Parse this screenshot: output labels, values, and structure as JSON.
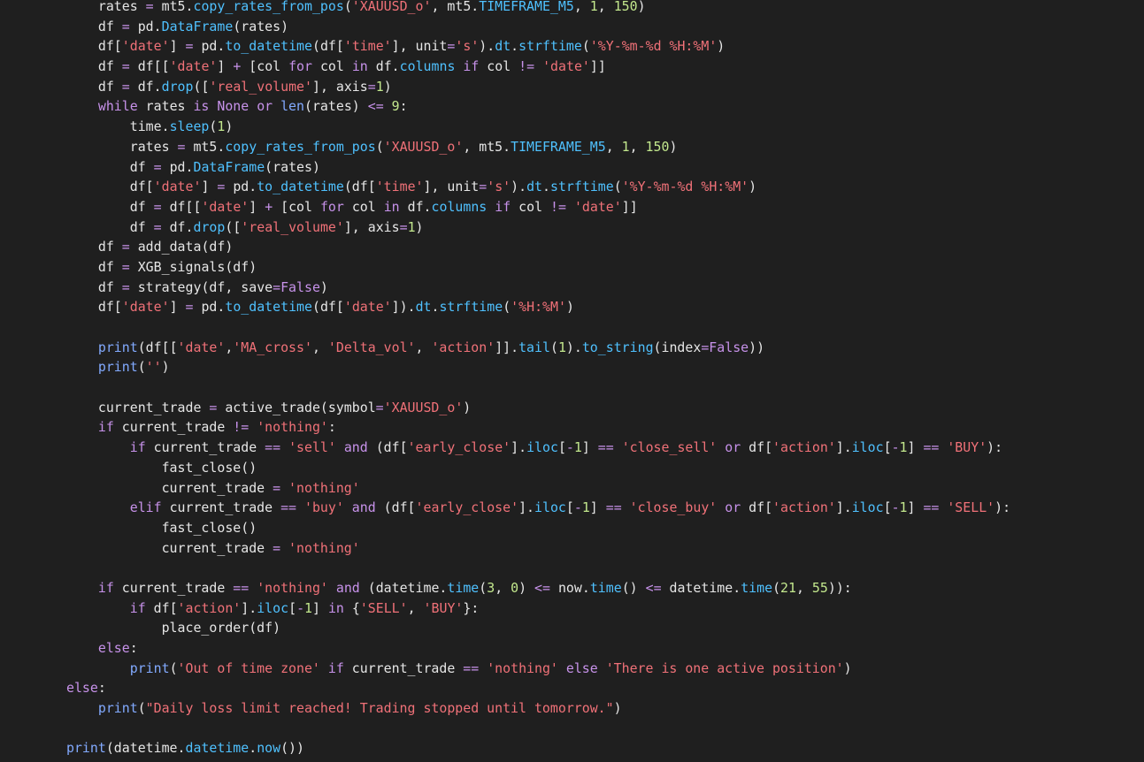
{
  "colors": {
    "background": "#1f1f1f",
    "plain": "#e6e6e6",
    "keyword": "#c792ea",
    "builtin": "#82aaff",
    "function": "#4fc1ff",
    "string": "#f07178",
    "number": "#c3e88d",
    "operator": "#c792ea",
    "bracket": "#ffd700"
  },
  "code_lines": [
    {
      "indent": 1,
      "tokens": [
        [
          "p",
          "rates "
        ],
        [
          "o",
          "= "
        ],
        [
          "p",
          "mt5."
        ],
        [
          "f",
          "copy_rates_from_pos"
        ],
        [
          "p",
          "("
        ],
        [
          "s",
          "'XAUUSD_o'"
        ],
        [
          "p",
          ", mt5."
        ],
        [
          "f",
          "TIMEFRAME_M5"
        ],
        [
          "p",
          ", "
        ],
        [
          "n",
          "1"
        ],
        [
          "p",
          ", "
        ],
        [
          "n",
          "150"
        ],
        [
          "p",
          ")"
        ]
      ]
    },
    {
      "indent": 1,
      "tokens": [
        [
          "p",
          "df "
        ],
        [
          "o",
          "= "
        ],
        [
          "p",
          "pd."
        ],
        [
          "f",
          "DataFrame"
        ],
        [
          "p",
          "(rates)"
        ]
      ]
    },
    {
      "indent": 1,
      "tokens": [
        [
          "p",
          "df["
        ],
        [
          "s",
          "'date'"
        ],
        [
          "p",
          "] "
        ],
        [
          "o",
          "= "
        ],
        [
          "p",
          "pd."
        ],
        [
          "f",
          "to_datetime"
        ],
        [
          "p",
          "(df["
        ],
        [
          "s",
          "'time'"
        ],
        [
          "p",
          "], unit"
        ],
        [
          "o",
          "="
        ],
        [
          "s",
          "'s'"
        ],
        [
          "p",
          ")."
        ],
        [
          "f",
          "dt"
        ],
        [
          "p",
          "."
        ],
        [
          "f",
          "strftime"
        ],
        [
          "p",
          "("
        ],
        [
          "s",
          "'%Y-%m-%d %H:%M'"
        ],
        [
          "p",
          ")"
        ]
      ]
    },
    {
      "indent": 1,
      "tokens": [
        [
          "p",
          "df "
        ],
        [
          "o",
          "= "
        ],
        [
          "p",
          "df[["
        ],
        [
          "s",
          "'date'"
        ],
        [
          "p",
          "] "
        ],
        [
          "o",
          "+ "
        ],
        [
          "p",
          "[col "
        ],
        [
          "k",
          "for "
        ],
        [
          "p",
          "col "
        ],
        [
          "k",
          "in "
        ],
        [
          "p",
          "df."
        ],
        [
          "f",
          "columns "
        ],
        [
          "k",
          "if "
        ],
        [
          "p",
          "col "
        ],
        [
          "o",
          "!= "
        ],
        [
          "s",
          "'date'"
        ],
        [
          "p",
          "]]"
        ]
      ]
    },
    {
      "indent": 1,
      "tokens": [
        [
          "p",
          "df "
        ],
        [
          "o",
          "= "
        ],
        [
          "p",
          "df."
        ],
        [
          "f",
          "drop"
        ],
        [
          "p",
          "(["
        ],
        [
          "s",
          "'real_volume'"
        ],
        [
          "p",
          "], axis"
        ],
        [
          "o",
          "="
        ],
        [
          "n",
          "1"
        ],
        [
          "p",
          ")"
        ]
      ]
    },
    {
      "indent": 1,
      "tokens": [
        [
          "k",
          "while "
        ],
        [
          "p",
          "rates "
        ],
        [
          "k",
          "is None or "
        ],
        [
          "b",
          "len"
        ],
        [
          "p",
          "(rates) "
        ],
        [
          "o",
          "<= "
        ],
        [
          "n",
          "9"
        ],
        [
          "p",
          ":"
        ]
      ]
    },
    {
      "indent": 2,
      "tokens": [
        [
          "p",
          "time."
        ],
        [
          "f",
          "sleep"
        ],
        [
          "p",
          "("
        ],
        [
          "n",
          "1"
        ],
        [
          "p",
          ")"
        ]
      ]
    },
    {
      "indent": 2,
      "tokens": [
        [
          "p",
          "rates "
        ],
        [
          "o",
          "= "
        ],
        [
          "p",
          "mt5."
        ],
        [
          "f",
          "copy_rates_from_pos"
        ],
        [
          "p",
          "("
        ],
        [
          "s",
          "'XAUUSD_o'"
        ],
        [
          "p",
          ", mt5."
        ],
        [
          "f",
          "TIMEFRAME_M5"
        ],
        [
          "p",
          ", "
        ],
        [
          "n",
          "1"
        ],
        [
          "p",
          ", "
        ],
        [
          "n",
          "150"
        ],
        [
          "p",
          ")"
        ]
      ]
    },
    {
      "indent": 2,
      "tokens": [
        [
          "p",
          "df "
        ],
        [
          "o",
          "= "
        ],
        [
          "p",
          "pd."
        ],
        [
          "f",
          "DataFrame"
        ],
        [
          "p",
          "(rates)"
        ]
      ]
    },
    {
      "indent": 2,
      "tokens": [
        [
          "p",
          "df["
        ],
        [
          "s",
          "'date'"
        ],
        [
          "p",
          "] "
        ],
        [
          "o",
          "= "
        ],
        [
          "p",
          "pd."
        ],
        [
          "f",
          "to_datetime"
        ],
        [
          "p",
          "(df["
        ],
        [
          "s",
          "'time'"
        ],
        [
          "p",
          "], unit"
        ],
        [
          "o",
          "="
        ],
        [
          "s",
          "'s'"
        ],
        [
          "p",
          ")."
        ],
        [
          "f",
          "dt"
        ],
        [
          "p",
          "."
        ],
        [
          "f",
          "strftime"
        ],
        [
          "p",
          "("
        ],
        [
          "s",
          "'%Y-%m-%d %H:%M'"
        ],
        [
          "p",
          ")"
        ]
      ]
    },
    {
      "indent": 2,
      "tokens": [
        [
          "p",
          "df "
        ],
        [
          "o",
          "= "
        ],
        [
          "p",
          "df[["
        ],
        [
          "s",
          "'date'"
        ],
        [
          "p",
          "] "
        ],
        [
          "o",
          "+ "
        ],
        [
          "p",
          "[col "
        ],
        [
          "k",
          "for "
        ],
        [
          "p",
          "col "
        ],
        [
          "k",
          "in "
        ],
        [
          "p",
          "df."
        ],
        [
          "f",
          "columns "
        ],
        [
          "k",
          "if "
        ],
        [
          "p",
          "col "
        ],
        [
          "o",
          "!= "
        ],
        [
          "s",
          "'date'"
        ],
        [
          "p",
          "]]"
        ]
      ]
    },
    {
      "indent": 2,
      "tokens": [
        [
          "p",
          "df "
        ],
        [
          "o",
          "= "
        ],
        [
          "p",
          "df."
        ],
        [
          "f",
          "drop"
        ],
        [
          "p",
          "(["
        ],
        [
          "s",
          "'real_volume'"
        ],
        [
          "p",
          "], axis"
        ],
        [
          "o",
          "="
        ],
        [
          "n",
          "1"
        ],
        [
          "p",
          ")"
        ]
      ]
    },
    {
      "indent": 1,
      "tokens": [
        [
          "p",
          "df "
        ],
        [
          "o",
          "= "
        ],
        [
          "p",
          "add_data(df)"
        ]
      ]
    },
    {
      "indent": 1,
      "tokens": [
        [
          "p",
          "df "
        ],
        [
          "o",
          "= "
        ],
        [
          "p",
          "XGB_signals(df)"
        ]
      ]
    },
    {
      "indent": 1,
      "tokens": [
        [
          "p",
          "df "
        ],
        [
          "o",
          "= "
        ],
        [
          "p",
          "strategy(df, save"
        ],
        [
          "o",
          "="
        ],
        [
          "k",
          "False"
        ],
        [
          "p",
          ")"
        ]
      ]
    },
    {
      "indent": 1,
      "tokens": [
        [
          "p",
          "df["
        ],
        [
          "s",
          "'date'"
        ],
        [
          "p",
          "] "
        ],
        [
          "o",
          "= "
        ],
        [
          "p",
          "pd."
        ],
        [
          "f",
          "to_datetime"
        ],
        [
          "p",
          "(df["
        ],
        [
          "s",
          "'date'"
        ],
        [
          "p",
          "])."
        ],
        [
          "f",
          "dt"
        ],
        [
          "p",
          "."
        ],
        [
          "f",
          "strftime"
        ],
        [
          "p",
          "("
        ],
        [
          "s",
          "'%H:%M'"
        ],
        [
          "p",
          ")"
        ]
      ]
    },
    {
      "indent": 0,
      "tokens": []
    },
    {
      "indent": 1,
      "tokens": [
        [
          "b",
          "print"
        ],
        [
          "p",
          "(df[["
        ],
        [
          "s",
          "'date'"
        ],
        [
          "p",
          ","
        ],
        [
          "s",
          "'MA_cross'"
        ],
        [
          "p",
          ", "
        ],
        [
          "s",
          "'Delta_vol'"
        ],
        [
          "p",
          ", "
        ],
        [
          "s",
          "'action'"
        ],
        [
          "p",
          "]]."
        ],
        [
          "f",
          "tail"
        ],
        [
          "p",
          "("
        ],
        [
          "n",
          "1"
        ],
        [
          "p",
          ")."
        ],
        [
          "f",
          "to_string"
        ],
        [
          "p",
          "(index"
        ],
        [
          "o",
          "="
        ],
        [
          "k",
          "False"
        ],
        [
          "p",
          "))"
        ]
      ]
    },
    {
      "indent": 1,
      "tokens": [
        [
          "b",
          "print"
        ],
        [
          "p",
          "("
        ],
        [
          "s",
          "''"
        ],
        [
          "p",
          ")"
        ]
      ]
    },
    {
      "indent": 0,
      "tokens": []
    },
    {
      "indent": 1,
      "tokens": [
        [
          "p",
          "current_trade "
        ],
        [
          "o",
          "= "
        ],
        [
          "p",
          "active_trade(symbol"
        ],
        [
          "o",
          "="
        ],
        [
          "s",
          "'XAUUSD_o'"
        ],
        [
          "p",
          ")"
        ]
      ]
    },
    {
      "indent": 1,
      "tokens": [
        [
          "k",
          "if "
        ],
        [
          "p",
          "current_trade "
        ],
        [
          "o",
          "!= "
        ],
        [
          "s",
          "'nothing'"
        ],
        [
          "p",
          ":"
        ]
      ]
    },
    {
      "indent": 2,
      "tokens": [
        [
          "k",
          "if "
        ],
        [
          "p",
          "current_trade "
        ],
        [
          "o",
          "== "
        ],
        [
          "s",
          "'sell' "
        ],
        [
          "k",
          "and "
        ],
        [
          "p",
          "(df["
        ],
        [
          "s",
          "'early_close'"
        ],
        [
          "p",
          "]."
        ],
        [
          "f",
          "iloc"
        ],
        [
          "p",
          "["
        ],
        [
          "o",
          "-"
        ],
        [
          "n",
          "1"
        ],
        [
          "p",
          "] "
        ],
        [
          "o",
          "== "
        ],
        [
          "s",
          "'close_sell' "
        ],
        [
          "k",
          "or "
        ],
        [
          "p",
          "df["
        ],
        [
          "s",
          "'action'"
        ],
        [
          "p",
          "]."
        ],
        [
          "f",
          "iloc"
        ],
        [
          "p",
          "["
        ],
        [
          "o",
          "-"
        ],
        [
          "n",
          "1"
        ],
        [
          "p",
          "] "
        ],
        [
          "o",
          "== "
        ],
        [
          "s",
          "'BUY'"
        ],
        [
          "p",
          "):"
        ]
      ]
    },
    {
      "indent": 3,
      "tokens": [
        [
          "p",
          "fast_close()"
        ]
      ]
    },
    {
      "indent": 3,
      "tokens": [
        [
          "p",
          "current_trade "
        ],
        [
          "o",
          "= "
        ],
        [
          "s",
          "'nothing'"
        ]
      ]
    },
    {
      "indent": 2,
      "tokens": [
        [
          "k",
          "elif "
        ],
        [
          "p",
          "current_trade "
        ],
        [
          "o",
          "== "
        ],
        [
          "s",
          "'buy' "
        ],
        [
          "k",
          "and "
        ],
        [
          "p",
          "(df["
        ],
        [
          "s",
          "'early_close'"
        ],
        [
          "p",
          "]."
        ],
        [
          "f",
          "iloc"
        ],
        [
          "p",
          "["
        ],
        [
          "o",
          "-"
        ],
        [
          "n",
          "1"
        ],
        [
          "p",
          "] "
        ],
        [
          "o",
          "== "
        ],
        [
          "s",
          "'close_buy' "
        ],
        [
          "k",
          "or "
        ],
        [
          "p",
          "df["
        ],
        [
          "s",
          "'action'"
        ],
        [
          "p",
          "]."
        ],
        [
          "f",
          "iloc"
        ],
        [
          "p",
          "["
        ],
        [
          "o",
          "-"
        ],
        [
          "n",
          "1"
        ],
        [
          "p",
          "] "
        ],
        [
          "o",
          "== "
        ],
        [
          "s",
          "'SELL'"
        ],
        [
          "p",
          "):"
        ]
      ]
    },
    {
      "indent": 3,
      "tokens": [
        [
          "p",
          "fast_close()"
        ]
      ]
    },
    {
      "indent": 3,
      "tokens": [
        [
          "p",
          "current_trade "
        ],
        [
          "o",
          "= "
        ],
        [
          "s",
          "'nothing'"
        ]
      ]
    },
    {
      "indent": 0,
      "tokens": []
    },
    {
      "indent": 1,
      "tokens": [
        [
          "k",
          "if "
        ],
        [
          "p",
          "current_trade "
        ],
        [
          "o",
          "== "
        ],
        [
          "s",
          "'nothing' "
        ],
        [
          "k",
          "and "
        ],
        [
          "p",
          "(datetime."
        ],
        [
          "f",
          "time"
        ],
        [
          "p",
          "("
        ],
        [
          "n",
          "3"
        ],
        [
          "p",
          ", "
        ],
        [
          "n",
          "0"
        ],
        [
          "p",
          ") "
        ],
        [
          "o",
          "<= "
        ],
        [
          "p",
          "now."
        ],
        [
          "f",
          "time"
        ],
        [
          "p",
          "() "
        ],
        [
          "o",
          "<= "
        ],
        [
          "p",
          "datetime."
        ],
        [
          "f",
          "time"
        ],
        [
          "p",
          "("
        ],
        [
          "n",
          "21"
        ],
        [
          "p",
          ", "
        ],
        [
          "n",
          "55"
        ],
        [
          "p",
          "))"
        ],
        [
          "p",
          ":"
        ]
      ]
    },
    {
      "indent": 2,
      "tokens": [
        [
          "k",
          "if "
        ],
        [
          "p",
          "df["
        ],
        [
          "s",
          "'action'"
        ],
        [
          "p",
          "]."
        ],
        [
          "f",
          "iloc"
        ],
        [
          "p",
          "["
        ],
        [
          "o",
          "-"
        ],
        [
          "n",
          "1"
        ],
        [
          "p",
          "] "
        ],
        [
          "k",
          "in "
        ],
        [
          "p",
          "{"
        ],
        [
          "s",
          "'SELL'"
        ],
        [
          "p",
          ", "
        ],
        [
          "s",
          "'BUY'"
        ],
        [
          "p",
          "}:"
        ]
      ]
    },
    {
      "indent": 3,
      "tokens": [
        [
          "p",
          "place_order(df)"
        ]
      ]
    },
    {
      "indent": 1,
      "tokens": [
        [
          "k",
          "else"
        ],
        [
          "p",
          ":"
        ]
      ]
    },
    {
      "indent": 2,
      "tokens": [
        [
          "b",
          "print"
        ],
        [
          "p",
          "("
        ],
        [
          "s",
          "'Out of time zone' "
        ],
        [
          "k",
          "if "
        ],
        [
          "p",
          "current_trade "
        ],
        [
          "o",
          "== "
        ],
        [
          "s",
          "'nothing' "
        ],
        [
          "k",
          "else "
        ],
        [
          "s",
          "'There is one active position'"
        ],
        [
          "p",
          ")"
        ]
      ]
    },
    {
      "indent": 0,
      "tokens": [
        [
          "k",
          "else"
        ],
        [
          "p",
          ":"
        ]
      ]
    },
    {
      "indent": 1,
      "tokens": [
        [
          "b",
          "print"
        ],
        [
          "p",
          "("
        ],
        [
          "s",
          "\"Daily loss limit reached! Trading stopped until tomorrow.\""
        ],
        [
          "p",
          ")"
        ]
      ]
    },
    {
      "indent": 0,
      "tokens": []
    },
    {
      "indent": 0,
      "tokens": [
        [
          "b",
          "print"
        ],
        [
          "p",
          "(datetime."
        ],
        [
          "f",
          "datetime"
        ],
        [
          "p",
          "."
        ],
        [
          "f",
          "now"
        ],
        [
          "p",
          "())"
        ]
      ]
    }
  ]
}
